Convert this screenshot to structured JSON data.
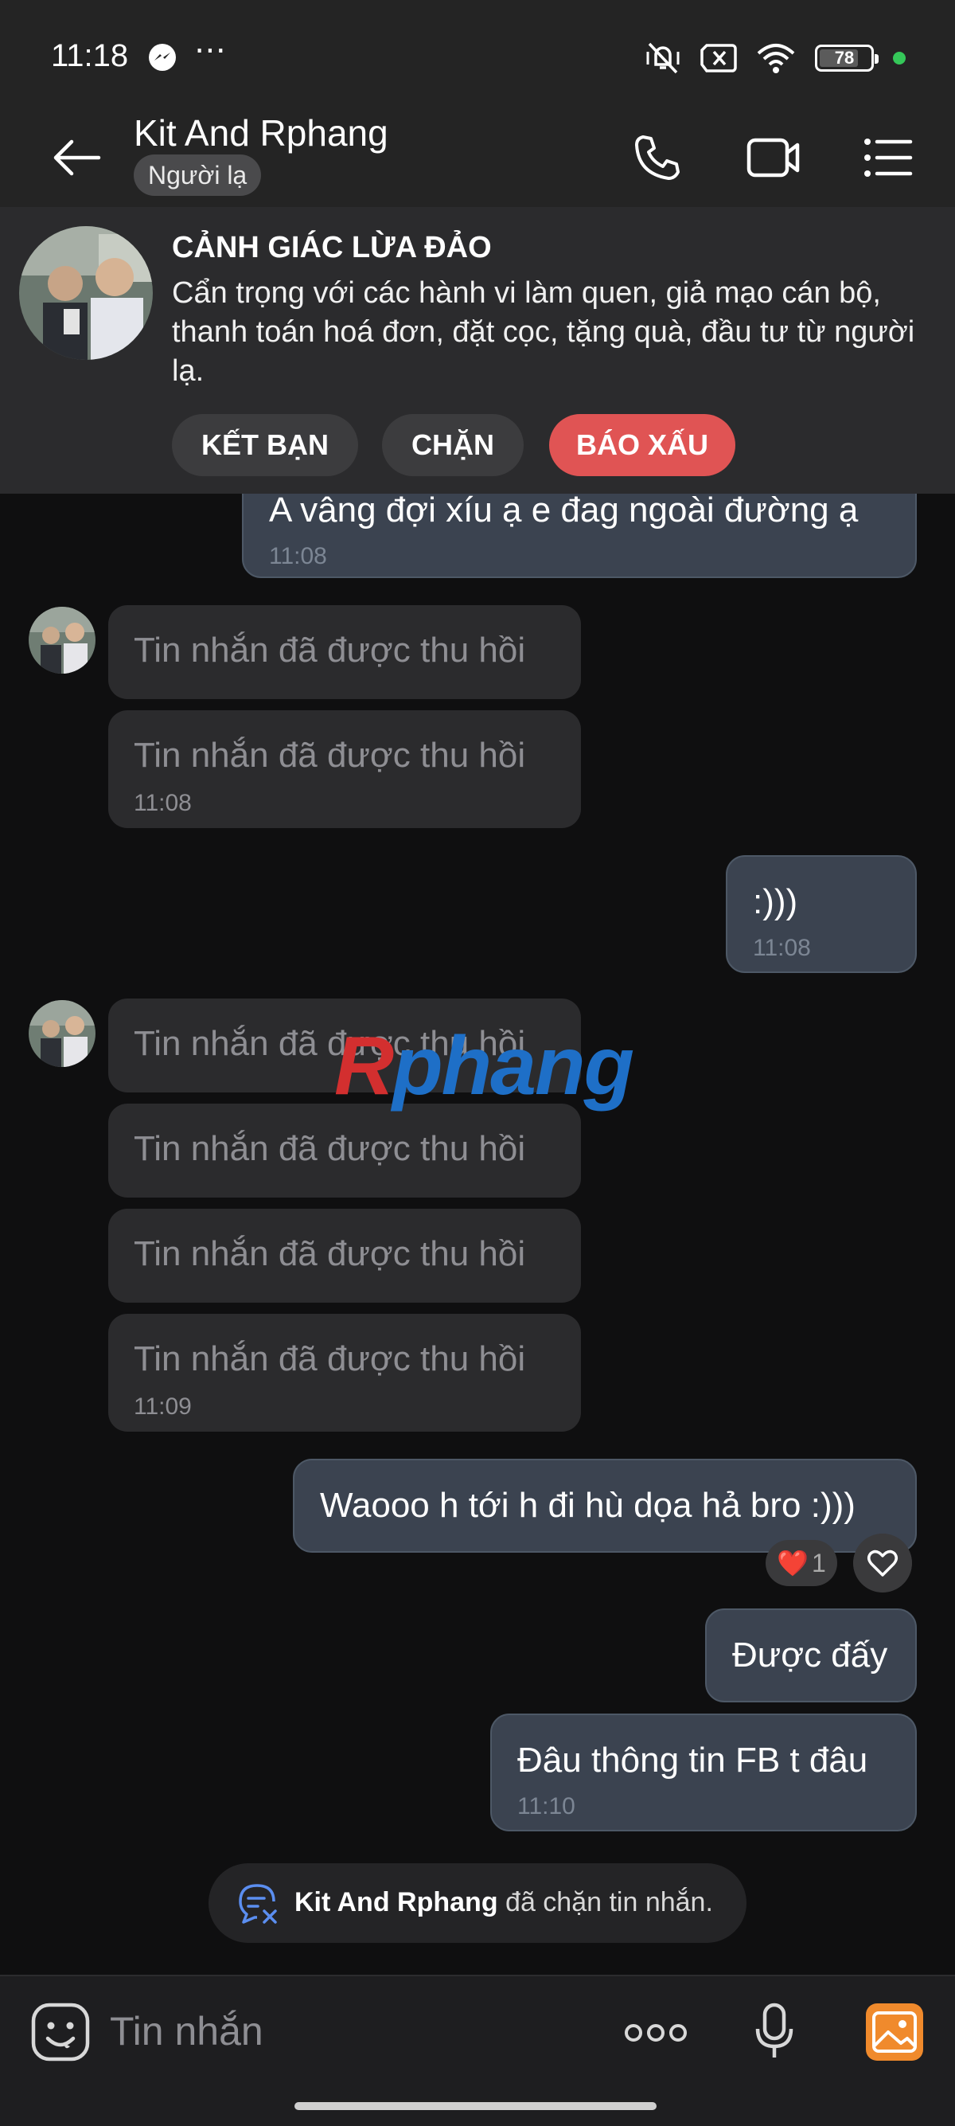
{
  "status_bar": {
    "time": "11:18",
    "overflow": "⋯",
    "battery": "78",
    "battery_level": 0.78
  },
  "header": {
    "contact_name": "Kit And Rphang",
    "badge": "Người lạ"
  },
  "warning": {
    "title": "CẢNH GIÁC LỪA ĐẢO",
    "text": "Cẩn trọng với các hành vi làm quen, giả mạo cán bộ, thanh toán hoá đơn, đặt cọc, tặng quà, đầu tư từ người lạ.",
    "buttons": {
      "add_friend": "KẾT BẠN",
      "block": "CHẶN",
      "report": "BÁO XẤU"
    },
    "report_color": "#e05454"
  },
  "messages": [
    {
      "from": "me",
      "text": "A vâng đợi xíu ạ e đag ngoài đường ạ",
      "time": "11:08"
    },
    {
      "from": "them",
      "text": "Tin nhắn đã được thu hồi"
    },
    {
      "from": "them",
      "text": "Tin nhắn đã được thu hồi",
      "time": "11:08"
    },
    {
      "from": "me",
      "text": ":)))",
      "time": "11:08"
    },
    {
      "from": "them",
      "text": "Tin nhắn đã được thu hồi"
    },
    {
      "from": "them",
      "text": "Tin nhắn đã được thu hồi"
    },
    {
      "from": "them",
      "text": "Tin nhắn đã được thu hồi"
    },
    {
      "from": "them",
      "text": "Tin nhắn đã được thu hồi",
      "time": "11:09"
    },
    {
      "from": "me",
      "text": "Waooo h tới h đi hù dọa hả bro :)))",
      "reaction": {
        "emoji": "❤️",
        "count": "1"
      }
    },
    {
      "from": "me",
      "text": "Được đấy"
    },
    {
      "from": "me",
      "text": "Đâu thông tin FB t đâu",
      "time": "11:10"
    }
  ],
  "watermark": {
    "part1": "R",
    "part2": "phang"
  },
  "system_note": {
    "name": "Kit And Rphang",
    "text": " đã chặn tin nhắn."
  },
  "input": {
    "placeholder": "Tin nhắn"
  },
  "icons": [
    "back-arrow-icon",
    "phone-icon",
    "video-icon",
    "menu-list-icon",
    "emoji-icon",
    "more-icon",
    "mic-icon",
    "image-icon",
    "heart-icon"
  ]
}
